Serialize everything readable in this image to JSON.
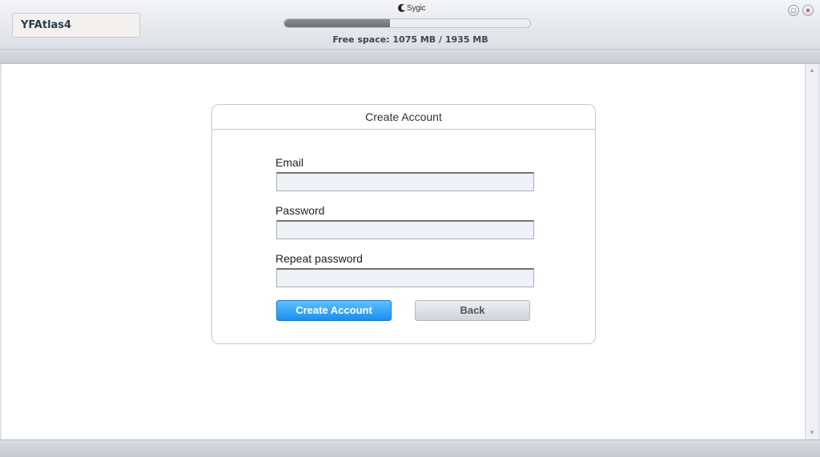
{
  "header": {
    "device_name": "YFAtlas4",
    "logo_text": "Sygic",
    "storage_progress": 0.43,
    "free_space_text": "Free space: 1075 MB / 1935 MB",
    "restore_icon": "restore-icon",
    "close_icon": "close-icon"
  },
  "form": {
    "title": "Create Account",
    "email_label": "Email",
    "email_value": "",
    "password_label": "Password",
    "password_value": "",
    "repeat_password_label": "Repeat password",
    "repeat_password_value": "",
    "create_button_label": "Create Account",
    "back_button_label": "Back"
  },
  "colors": {
    "primary_button": "#1a8ef0",
    "secondary_button": "#cfd3da"
  }
}
